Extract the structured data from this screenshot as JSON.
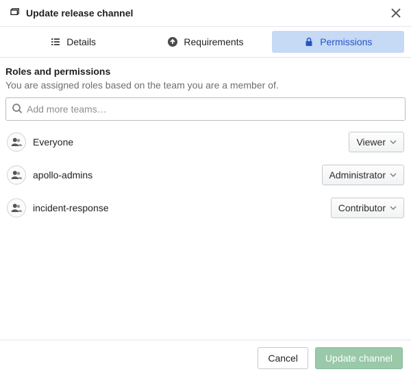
{
  "header": {
    "title": "Update release channel"
  },
  "tabs": {
    "details": "Details",
    "requirements": "Requirements",
    "permissions": "Permissions"
  },
  "permissions": {
    "section_title": "Roles and permissions",
    "section_sub": "You are assigned roles based on the team you are a member of.",
    "search_placeholder": "Add more teams…",
    "teams": [
      {
        "name": "Everyone",
        "role": "Viewer"
      },
      {
        "name": "apollo-admins",
        "role": "Administrator"
      },
      {
        "name": "incident-response",
        "role": "Contributor"
      }
    ]
  },
  "footer": {
    "cancel": "Cancel",
    "submit": "Update channel"
  }
}
